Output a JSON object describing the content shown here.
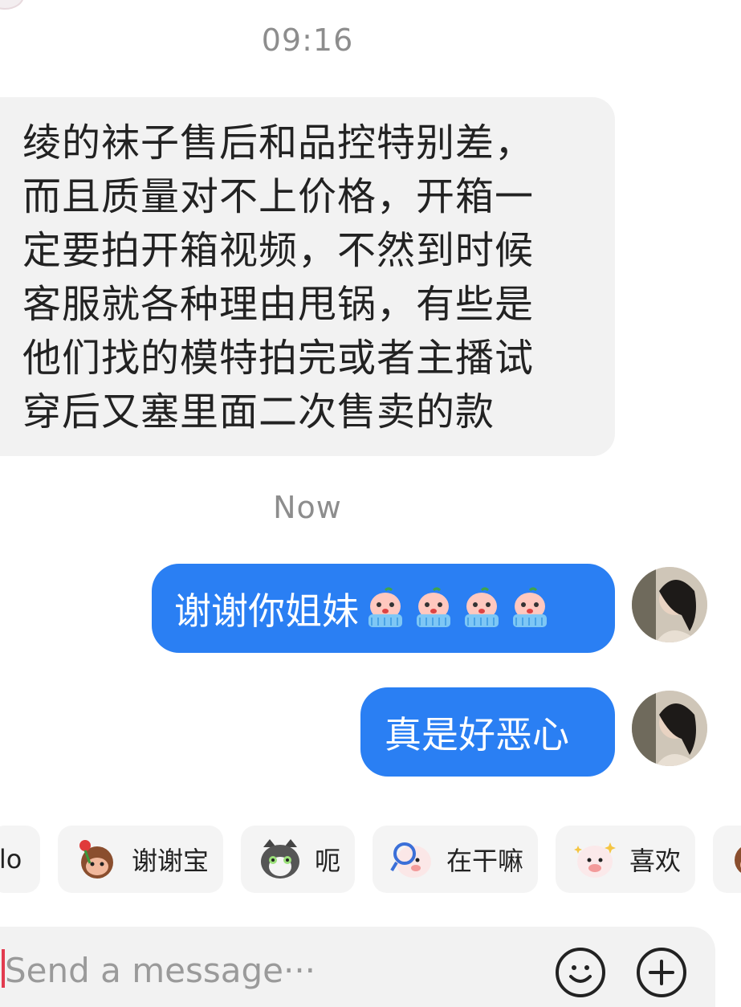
{
  "conversation": {
    "timestamp_1": "09:16",
    "incoming_message": {
      "lines": [
        "绫的袜子售后和品控特别差，",
        "而且质量对不上价格，开箱一",
        "定要拍开箱视频，不然到时候",
        "客服就各种理由甩锅，有些是",
        "他们找的模特拍完或者主播试",
        "穿后又塞里面二次售卖的款"
      ]
    },
    "timestamp_2": "Now",
    "outgoing_messages": [
      {
        "text": "谢谢你姐妹",
        "emoji_count": 4,
        "emoji": "crying-peach-sticker"
      },
      {
        "text": "真是好恶心"
      }
    ]
  },
  "quick_replies": [
    {
      "label": "llo",
      "sticker": "none"
    },
    {
      "label": "谢谢宝",
      "sticker": "monkey-with-rose-sticker"
    },
    {
      "label": "呃",
      "sticker": "gray-cat-sticker"
    },
    {
      "label": "在干嘛",
      "sticker": "magnifier-sheep-sticker"
    },
    {
      "label": "喜欢",
      "sticker": "sparkle-sheep-sticker"
    },
    {
      "label": "",
      "sticker": "monkey-sticker"
    }
  ],
  "composer": {
    "placeholder": "Send a message···",
    "emoji_button": "smiley-icon",
    "plus_button": "plus-icon"
  },
  "colors": {
    "outgoing_bubble": "#2a7ff3",
    "incoming_bubble": "#f2f2f2",
    "caret": "#e23b4f"
  }
}
